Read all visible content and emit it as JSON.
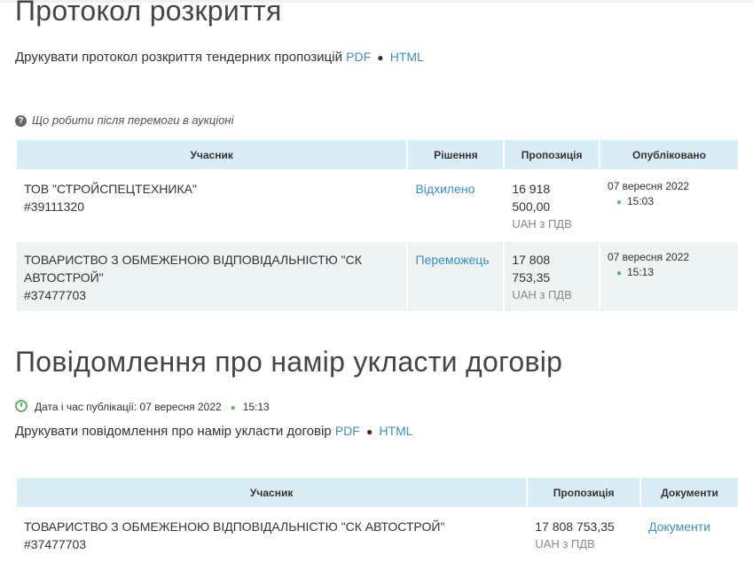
{
  "opening": {
    "title": "Протокол розкриття",
    "print_text": "Друкувати протокол розкриття тендерних пропозицій",
    "pdf": "PDF",
    "html": "HTML",
    "hint": "Що робити після перемоги в аукціоні",
    "table": {
      "headers": [
        "Учасник",
        "Рішення",
        "Пропозиція",
        "Опубліковано"
      ],
      "rows": [
        {
          "name": "ТОВ \"СТРОЙСПЕЦТЕХНИКА\"",
          "code": "#39111320",
          "decision": "Відхилено",
          "amount_line1": "16 918",
          "amount_line2": "500,00",
          "currency": "UAH з ПДВ",
          "date": "07 вересня 2022",
          "time": "15:03"
        },
        {
          "name": "ТОВАРИСТВО З ОБМЕЖЕНОЮ ВІДПОВІДАЛЬНІСТЮ \"СК АВТОСТРОЙ\"",
          "code": "#37477703",
          "decision": "Переможець",
          "amount_line1": "17 808",
          "amount_line2": "753,35",
          "currency": "UAH з ПДВ",
          "date": "07 вересня 2022",
          "time": "15:13"
        }
      ]
    }
  },
  "intent": {
    "title": "Повідомлення про намір укласти договір",
    "pub_label": "Дата і час публікації: 07 вересня 2022",
    "pub_time": "15:13",
    "print_text": "Друкувати повідомлення про намір укласти договір",
    "pdf": "PDF",
    "html": "HTML",
    "table": {
      "headers": [
        "Учасник",
        "Пропозиція",
        "Документи"
      ],
      "row": {
        "name": "ТОВАРИСТВО З ОБМЕЖЕНОЮ ВІДПОВІДАЛЬНІСТЮ \"СК АВТОСТРОЙ\"",
        "code": "#37477703",
        "amount": "17 808 753,35",
        "currency": "UAH з ПДВ",
        "docs": "Документи"
      }
    }
  }
}
